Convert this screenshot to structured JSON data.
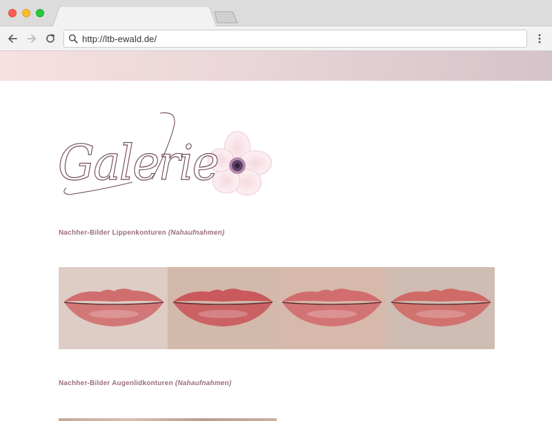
{
  "browser": {
    "url": "http://ltb-ewald.de/"
  },
  "page": {
    "logo_text": "Galerie",
    "sections": [
      {
        "title": "Nachher-Bilder Lippenkonturen",
        "subtitle": "(Nahaufnahmen)"
      },
      {
        "title": "Nachher-Bilder Augenlidkonturen",
        "subtitle": "(Nahaufnahmen)"
      }
    ],
    "gallery_1": [
      {
        "name": "lip-photo-1",
        "skin": "#dbc9c1",
        "lip": "#d06e6e"
      },
      {
        "name": "lip-photo-2",
        "skin": "#dcc2b6",
        "lip": "#c9595c"
      },
      {
        "name": "lip-photo-3",
        "skin": "#d3b4a4",
        "lip": "#d26d6f"
      },
      {
        "name": "lip-photo-4",
        "skin": "#d7c6bd",
        "lip": "#cf6a66"
      }
    ]
  },
  "colors": {
    "accent": "#9b6f7c",
    "header_band_start": "#f6e0e0",
    "header_band_end": "#d5c3c9"
  },
  "icons": {
    "back": "arrow-left-icon",
    "forward": "arrow-right-icon",
    "reload": "reload-icon",
    "search": "search-icon",
    "menu": "kebab-menu-icon"
  }
}
